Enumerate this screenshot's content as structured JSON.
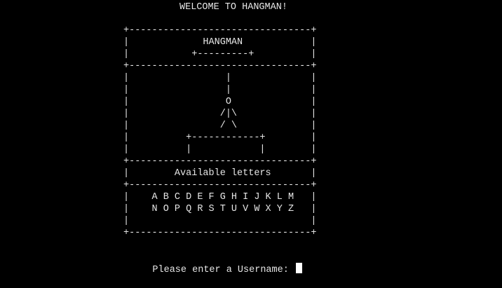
{
  "terminal": {
    "welcome": "WELCOME TO HANGMAN!",
    "board": [
      "+--------------------------------+",
      "|             HANGMAN            |",
      "|           +---------+          |",
      "+--------------------------------+",
      "|                 |              |",
      "|                 |              |",
      "|                 O              |",
      "|                /|\\             |",
      "|                / \\             |",
      "|          +------------+        |",
      "|          |            |        |",
      "+--------------------------------+",
      "|        Available letters       |",
      "+--------------------------------+",
      "|    A B C D E F G H I J K L M   |",
      "|    N O P Q R S T U V W X Y Z   |",
      "|                                |",
      "+--------------------------------+"
    ],
    "prompt": "Please enter a Username: "
  },
  "colors": {
    "background": "#000000",
    "text": "#e6e6e6",
    "cursor": "#ffffff"
  }
}
